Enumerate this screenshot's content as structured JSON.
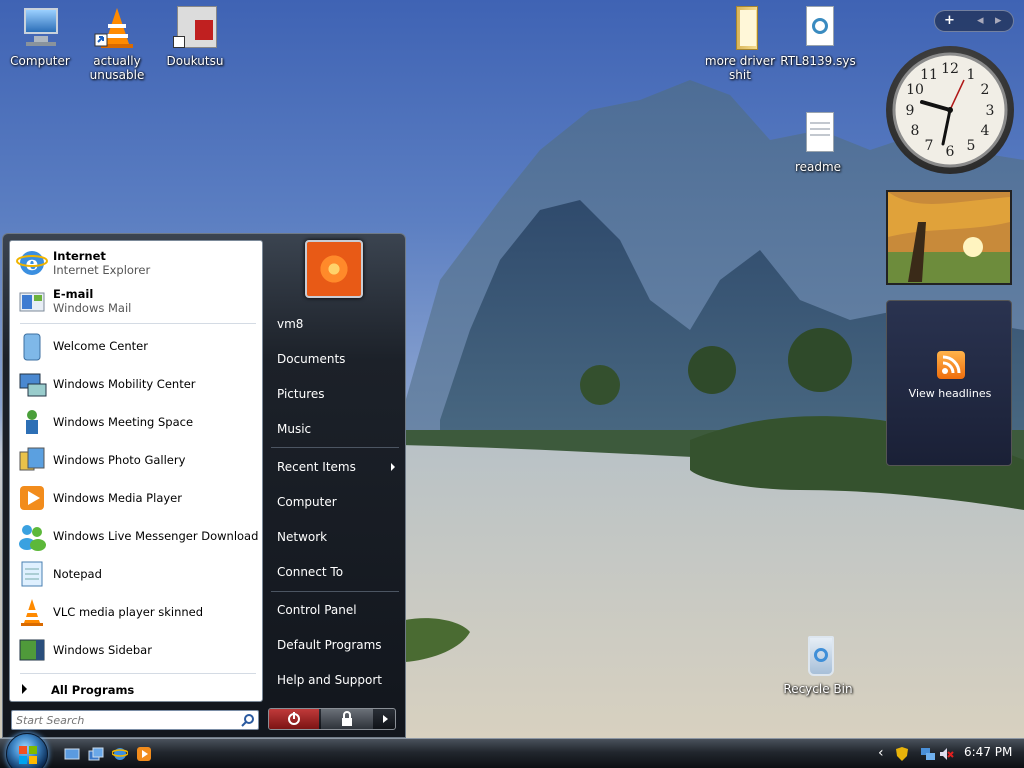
{
  "desktop_icons": [
    {
      "label": "Computer",
      "icon": "computer-icon"
    },
    {
      "label": "actually unusable",
      "icon": "vlc-cone-icon"
    },
    {
      "label": "Doukutsu",
      "icon": "game-shortcut-icon"
    },
    {
      "label": "more driver shit",
      "icon": "folder-icon"
    },
    {
      "label": "RTL8139.sys",
      "icon": "system-file-icon"
    },
    {
      "label": "readme",
      "icon": "text-file-icon"
    },
    {
      "label": "Recycle Bin",
      "icon": "recycle-bin-icon"
    }
  ],
  "sidebar": {
    "controls": {
      "add": "+",
      "prev": "◂",
      "next": "▸"
    },
    "clock_numbers": [
      "12",
      "1",
      "2",
      "3",
      "4",
      "5",
      "6",
      "7",
      "8",
      "9",
      "10",
      "11"
    ],
    "feed": {
      "label": "View headlines"
    }
  },
  "start_menu": {
    "pinned": [
      {
        "title": "Internet",
        "subtitle": "Internet Explorer",
        "icon": "internet-explorer-icon"
      },
      {
        "title": "E-mail",
        "subtitle": "Windows Mail",
        "icon": "windows-mail-icon"
      }
    ],
    "programs": [
      {
        "label": "Welcome Center",
        "icon": "welcome-center-icon"
      },
      {
        "label": "Windows Mobility Center",
        "icon": "mobility-center-icon"
      },
      {
        "label": "Windows Meeting Space",
        "icon": "meeting-space-icon"
      },
      {
        "label": "Windows Photo Gallery",
        "icon": "photo-gallery-icon"
      },
      {
        "label": "Windows Media Player",
        "icon": "media-player-icon"
      },
      {
        "label": "Windows Live Messenger Download",
        "icon": "messenger-icon"
      },
      {
        "label": "Notepad",
        "icon": "notepad-icon"
      },
      {
        "label": "VLC media player skinned",
        "icon": "vlc-icon"
      },
      {
        "label": "Windows Sidebar",
        "icon": "sidebar-icon"
      }
    ],
    "all_programs": "All Programs",
    "search_placeholder": "Start Search",
    "right_items": {
      "user": "vm8",
      "documents": "Documents",
      "pictures": "Pictures",
      "music": "Music",
      "recent": "Recent Items",
      "computer": "Computer",
      "network": "Network",
      "connect": "Connect To",
      "control_panel": "Control Panel",
      "default_programs": "Default Programs",
      "help": "Help and Support"
    }
  },
  "taskbar": {
    "quick_launch": [
      "show-desktop-icon",
      "switch-windows-icon",
      "internet-explorer-icon",
      "media-player-icon"
    ],
    "tray_arrow": "‹",
    "time": "6:47 PM"
  }
}
